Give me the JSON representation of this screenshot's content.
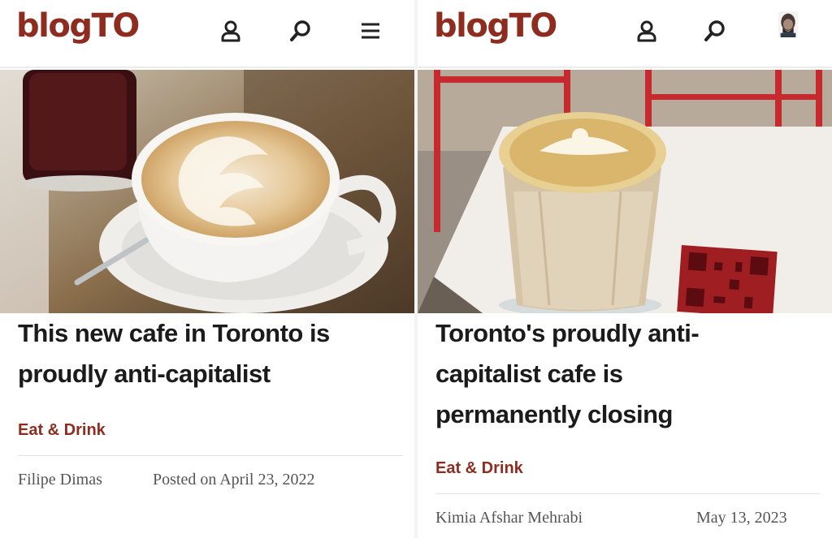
{
  "left": {
    "logo": "blogTO",
    "icons": [
      "user-icon",
      "search-icon",
      "menu-icon"
    ],
    "title_lines": [
      "This new cafe in Toronto is",
      "proudly anti-capitalist"
    ],
    "category": "Eat & Drink",
    "author": "Filipe Dimas",
    "date": "Posted on April 23, 2022"
  },
  "right": {
    "logo": "blogTO",
    "icons": [
      "user-icon",
      "search-icon",
      "avatar"
    ],
    "title_lines": [
      "Toronto's proudly anti-",
      "capitalist cafe is",
      "permanently closing"
    ],
    "category": "Eat & Drink",
    "author": "Kimia Afshar Mehrabi",
    "date": "May 13, 2023"
  },
  "colors": {
    "brand": "#8e2d1f",
    "title": "#1b1b1b",
    "meta": "#555555"
  }
}
